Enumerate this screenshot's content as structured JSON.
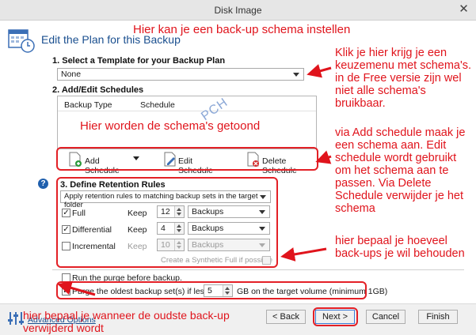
{
  "window": {
    "title": "Disk Image",
    "close_glyph": "✕"
  },
  "heading": "Edit the Plan for this Backup",
  "section1": {
    "title": "1. Select a Template for your Backup Plan",
    "template_value": "None"
  },
  "section2": {
    "title": "2. Add/Edit Schedules",
    "columns": [
      "Backup Type",
      "Schedule"
    ],
    "watermark": "PCH",
    "add_label": "Add Schedule",
    "edit_label": "Edit Schedule",
    "delete_label": "Delete Schedule"
  },
  "section3": {
    "title": "3. Define Retention Rules",
    "apply_value": "Apply retention rules to matching backup sets in the target folder",
    "rows": [
      {
        "label": "Full",
        "checked": true,
        "keep_label": "Keep",
        "value": "12",
        "unit": "Backups",
        "enabled": true
      },
      {
        "label": "Differential",
        "checked": true,
        "keep_label": "Keep",
        "value": "4",
        "unit": "Backups",
        "enabled": true
      },
      {
        "label": "Incremental",
        "checked": false,
        "keep_label": "Keep",
        "value": "10",
        "unit": "Backups",
        "enabled": false
      }
    ],
    "synthetic_label": "Create a Synthetic Full if possible"
  },
  "purge_before": {
    "label": "Run the purge before backup.",
    "checked": false
  },
  "purge_oldest": {
    "label": "Purge the oldest backup set(s) if less than",
    "value": "5",
    "suffix": "GB on the target volume (minimum 1GB)",
    "checked": true
  },
  "footer": {
    "advanced": "Advanced Options",
    "back": "< Back",
    "next": "Next >",
    "cancel": "Cancel",
    "finish": "Finish"
  },
  "annotations": {
    "top": "Hier kan je een back-up schema instellen",
    "template": "Klik je hier krijg je een keuzemenu met schema's. in de Free versie zijn wel niet alle schema's bruikbaar.",
    "list": "Hier worden de schema's getoond",
    "schedule": "via Add schedule maak je een schema aan. Edit schedule wordt gebruikt om het schema aan te passen. Via Delete Schedule verwijder je het schema",
    "retention": "hier bepaal je hoeveel back-ups je wil behouden",
    "purge": "hier bepaal je wanneer de oudste back-up verwijderd wordt"
  },
  "colors": {
    "annotation": "#e0141c",
    "heading": "#1a4f8f",
    "help_icon": "#1f5fad"
  }
}
